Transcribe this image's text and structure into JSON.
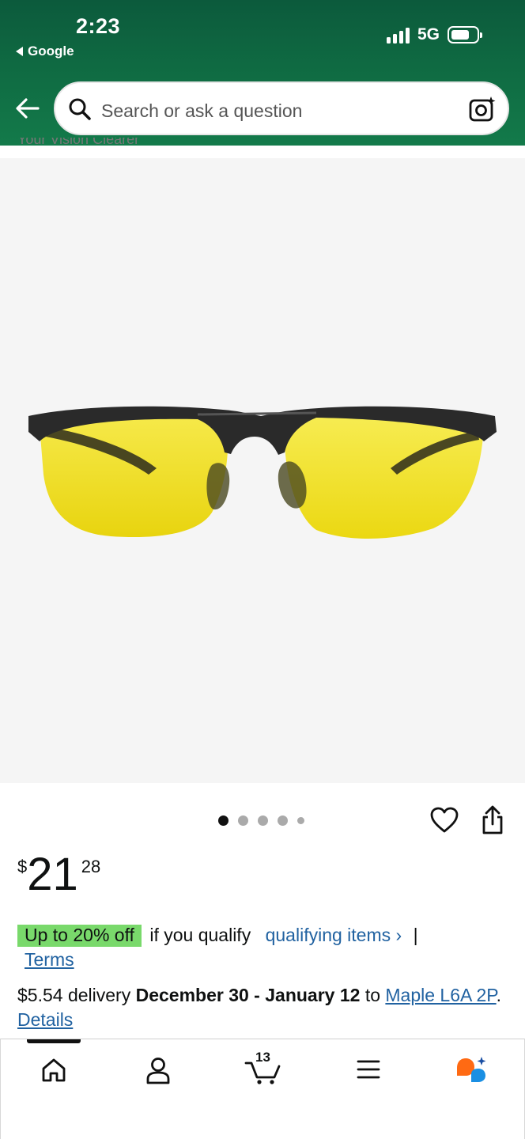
{
  "status_bar": {
    "time": "2:23",
    "back_app": "Google",
    "network": "5G"
  },
  "search": {
    "placeholder": "Search or ask a question"
  },
  "peek_text": "Your Vision Clearer",
  "carousel": {
    "total_images": 5,
    "active_index": 0
  },
  "price": {
    "currency": "$",
    "whole": "21",
    "fraction": "28"
  },
  "promo": {
    "badge": "Up to 20% off",
    "text": "if you qualify",
    "link": "qualifying items ›",
    "separator": "|",
    "terms": "Terms"
  },
  "delivery": {
    "fee": "$5.54 delivery",
    "dates": "December 30 - January 12",
    "to": "to",
    "location": "Maple L6A 2P",
    "details": "Details"
  },
  "bottom_nav": {
    "cart_count": "13",
    "items": [
      "home",
      "account",
      "cart",
      "menu",
      "rufus"
    ]
  },
  "colors": {
    "header_green": "#0f6a42",
    "promo_badge": "#79d96b",
    "link_blue": "#2162a1",
    "lens_yellow": "#f2e21a",
    "rufus_orange": "#ff6a13",
    "rufus_blue": "#1a8fe3"
  }
}
